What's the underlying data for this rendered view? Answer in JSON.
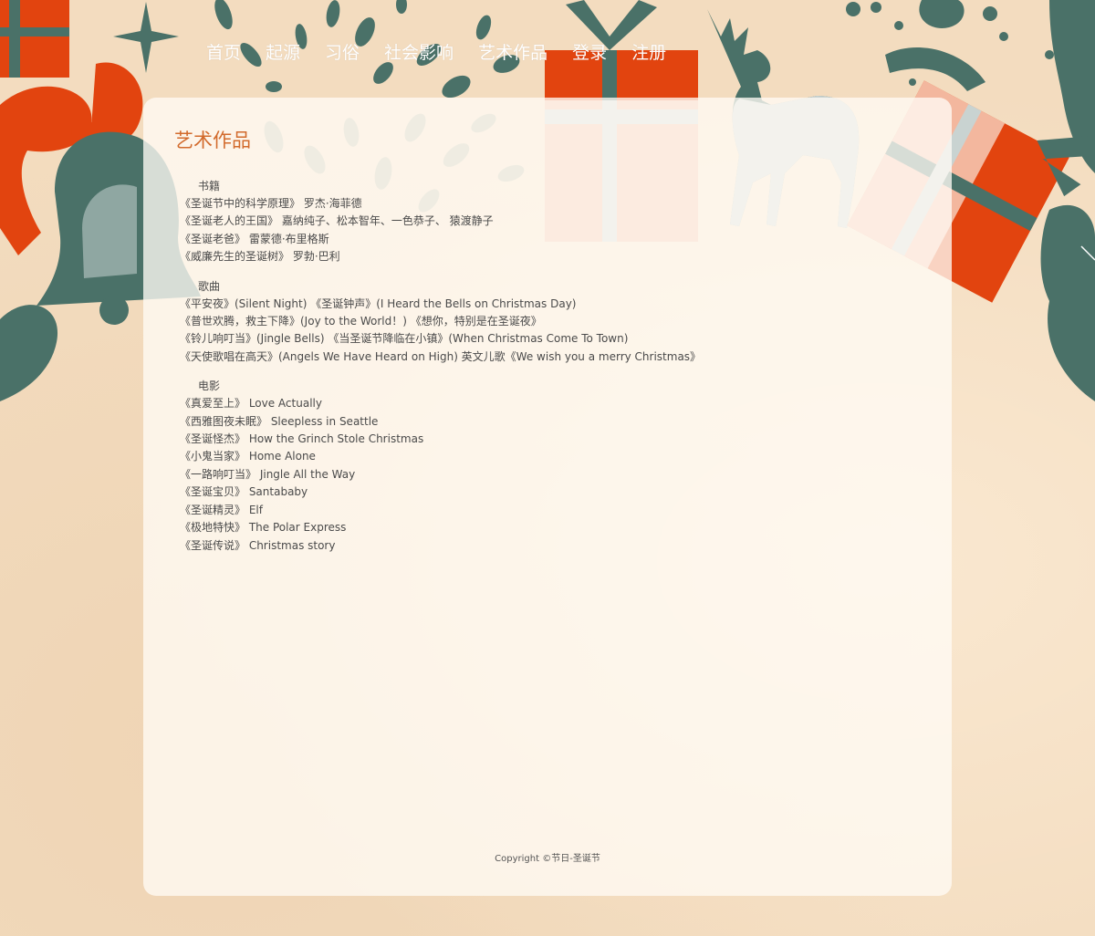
{
  "nav": {
    "items": [
      {
        "label": "首页"
      },
      {
        "label": "起源"
      },
      {
        "label": "习俗"
      },
      {
        "label": "社会影响"
      },
      {
        "label": "艺术作品"
      },
      {
        "label": "登录"
      },
      {
        "label": "注册"
      }
    ]
  },
  "page_title": "艺术作品",
  "sections": [
    {
      "heading": "书籍",
      "lines": [
        "《圣诞节中的科学原理》 罗杰·海菲德",
        "《圣诞老人的王国》 嘉纳纯子、松本智年、一色恭子、 猿渡静子",
        "《圣诞老爸》 雷蒙德·布里格斯",
        "《威廉先生的圣诞树》 罗勃·巴利"
      ]
    },
    {
      "heading": "歌曲",
      "lines": [
        "《平安夜》(Silent Night) 《圣诞钟声》(I Heard the Bells on Christmas Day)",
        "《普世欢腾，救主下降》(Joy to the World！) 《想你，特别是在圣诞夜》",
        "《铃儿响叮当》(Jingle Bells) 《当圣诞节降临在小镇》(When Christmas Come To Town)",
        "《天使歌唱在高天》(Angels We Have Heard on High) 英文儿歌《We wish you a merry Christmas》"
      ]
    },
    {
      "heading": "电影",
      "lines": [
        "《真爱至上》 Love Actually",
        "《西雅图夜未眠》 Sleepless in Seattle",
        "《圣诞怪杰》 How the Grinch Stole Christmas",
        "《小鬼当家》 Home Alone",
        "《一路响叮当》 Jingle All the Way",
        "《圣诞宝贝》 Santababy",
        "《圣诞精灵》 Elf",
        "《极地特快》 The Polar Express",
        "《圣诞传说》 Christmas story"
      ]
    }
  ],
  "footer": {
    "copyright": "Copyright ©节日-圣诞节"
  },
  "colors": {
    "accent": "#d26a2c",
    "teal": "#4a7168",
    "red": "#e2440f",
    "peach": "#f5c4ae",
    "mist": "#c9d3d1"
  }
}
